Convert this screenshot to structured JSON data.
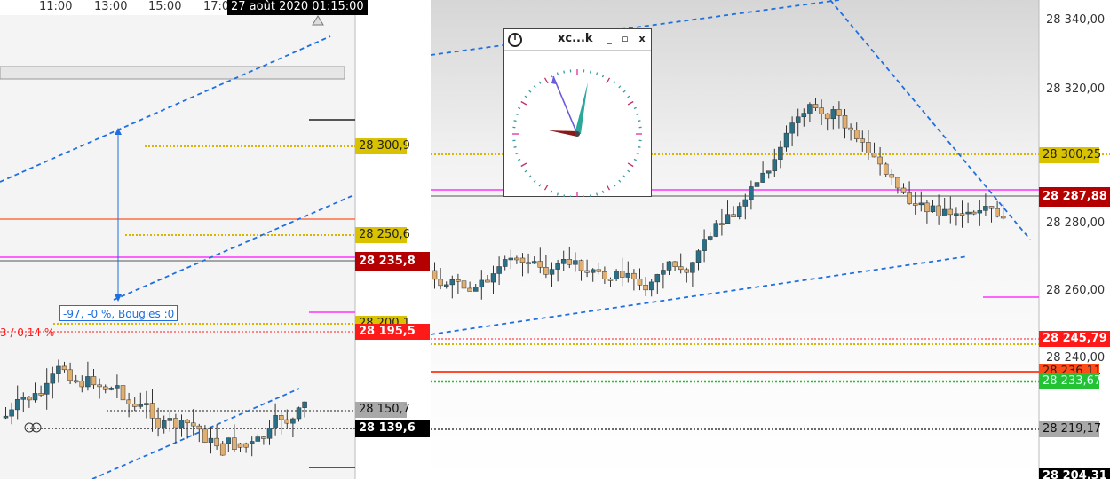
{
  "left_chart": {
    "time_labels": [
      "11:00",
      "13:00",
      "15:00",
      "17:0"
    ],
    "cursor_date": "27 août 2020 01:15:00",
    "price_labels": {
      "p1": "28 300,9",
      "p2": "28 250,6",
      "p3": "28 235,8",
      "p4": "28 200,1",
      "p5": "28 195,5",
      "p6": "28 150,7",
      "p7": "28 139,6"
    },
    "measure_text": "-97, -0 %, Bougies :0",
    "pct_text": "3 / 0,14 %"
  },
  "right_chart": {
    "axis_ticks": [
      "28 340,00",
      "28 320,00",
      "28 280,00",
      "28 260,00",
      "28 240,00"
    ],
    "price_labels": {
      "r1": "28 300,25",
      "r2": "28 287,88",
      "r3": "28 245,79",
      "r4": "28 236,11",
      "r5": "28 233,67",
      "r6": "28 219,17",
      "r7": "28 204,31"
    }
  },
  "clock": {
    "title": "xc...k",
    "minimize": "_",
    "maximize": "▫",
    "close": "x"
  },
  "colors": {
    "candle_up": "#2b6f86",
    "candle_down": "#e1b071",
    "trend_line": "#1f6fe0",
    "magenta": "#ff33ff",
    "gold": "#d7b500",
    "red_label": "#ff1a1a",
    "dark_red_label": "#b40000"
  }
}
